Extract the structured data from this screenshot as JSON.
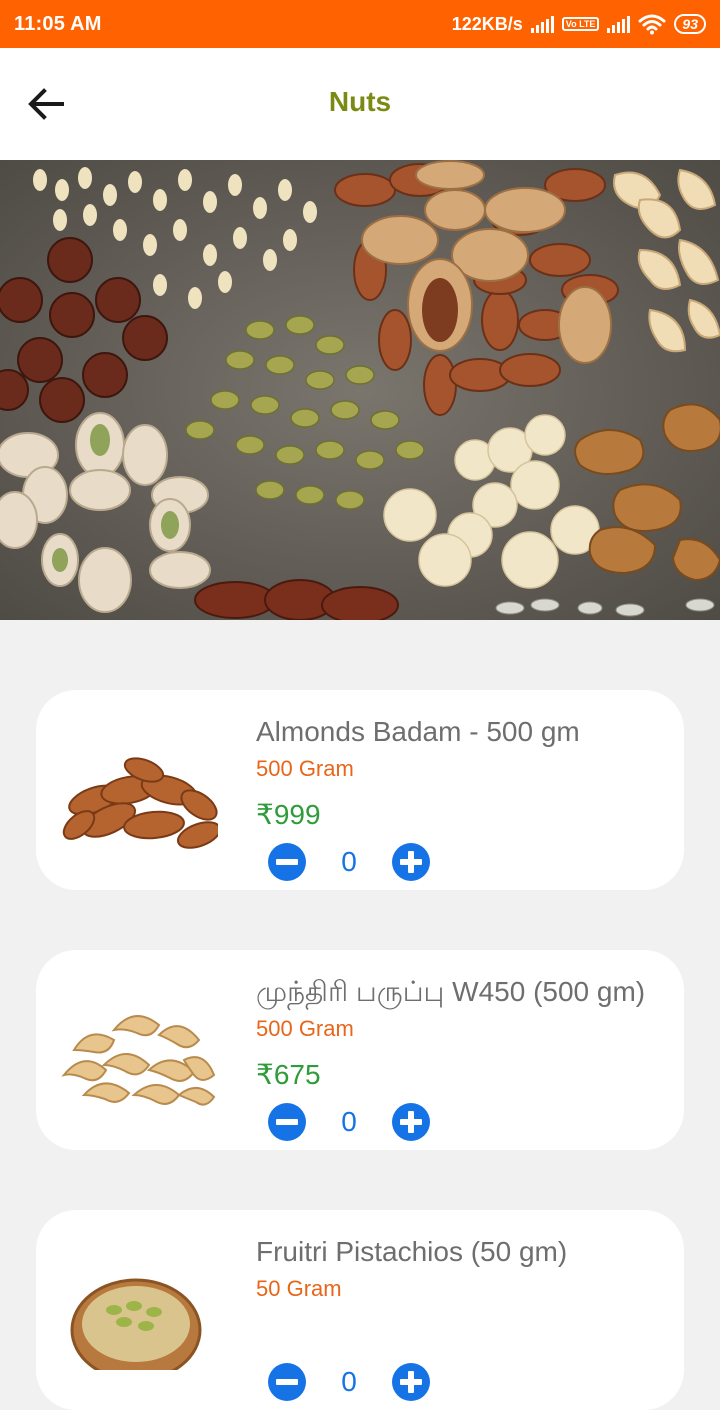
{
  "status_bar": {
    "time": "11:05 AM",
    "network_speed": "122KB/s",
    "volte": "Vo LTE",
    "battery": "93"
  },
  "app_bar": {
    "title": "Nuts",
    "back_icon": "arrow-left-icon"
  },
  "colors": {
    "status_bar": "#ff6200",
    "title": "#7a8a12",
    "quantity": "#e8661a",
    "price": "#2e9c3a",
    "stepper": "#1673e6"
  },
  "products": [
    {
      "name": "Almonds Badam - 500 gm",
      "quantity": "500 Gram",
      "price": "₹999",
      "count": "0"
    },
    {
      "name": "முந்திரி பருப்பு W450 (500 gm)",
      "quantity": "500 Gram",
      "price": "₹675",
      "count": "0"
    },
    {
      "name": "Fruitri Pistachios (50 gm)",
      "quantity": "50 Gram",
      "price": "",
      "count": "0"
    }
  ]
}
